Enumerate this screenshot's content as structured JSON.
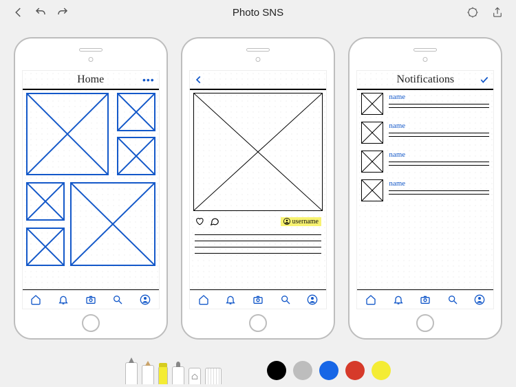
{
  "app": {
    "title": "Photo SNS"
  },
  "artboards": {
    "home": {
      "title": "Home"
    },
    "detail": {
      "username": "username"
    },
    "notifications": {
      "title": "Notifications",
      "items": [
        {
          "name": "name"
        },
        {
          "name": "name"
        },
        {
          "name": "name"
        },
        {
          "name": "name"
        }
      ]
    }
  },
  "palette": {
    "black": "#000000",
    "gray": "#bdbdbd",
    "blue": "#1766e6",
    "red": "#d63a2a",
    "yellow": "#f4ec34"
  }
}
